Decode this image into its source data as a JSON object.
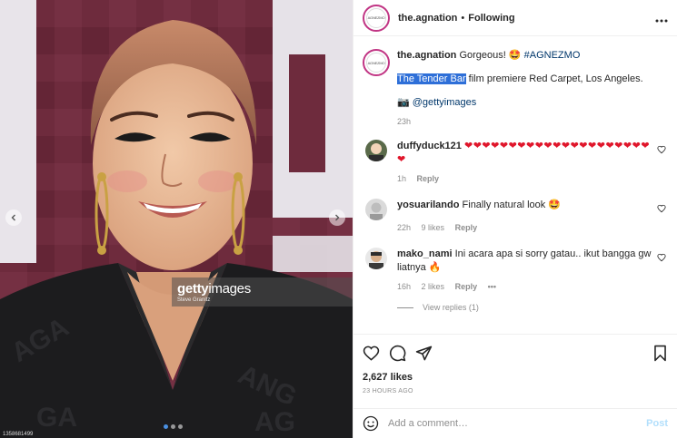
{
  "header": {
    "avatar_text": "AGNEZMO",
    "username": "the.agnation",
    "separator": "•",
    "follow_status": "Following",
    "more_icon": "more-horizontal-icon"
  },
  "media": {
    "watermark_logo_bold": "getty",
    "watermark_logo_light": "images",
    "watermark_credit": "Steve Granitz",
    "image_id": "1358681499",
    "slide_count": 3,
    "active_slide": 1
  },
  "caption": {
    "username": "the.agnation",
    "text": "Gorgeous! 🤩",
    "hashtag": "#AGNEZMO",
    "highlighted": "The Tender Bar",
    "line2_rest": " film premiere Red Carpet, Los Angeles.",
    "camera_emoji": "📷",
    "mention": "@gettyimages",
    "time": "23h"
  },
  "comments": [
    {
      "username": "duffyduck121",
      "text": "❤❤❤❤❤❤❤❤❤❤❤❤❤❤❤❤❤❤❤❤❤❤",
      "time": "1h",
      "likes": "",
      "reply_label": "Reply"
    },
    {
      "username": "yosuarilando",
      "text": "Finally natural look 🤩",
      "time": "22h",
      "likes": "9 likes",
      "reply_label": "Reply"
    },
    {
      "username": "mako_nami",
      "text": "Ini acara apa si sorry gatau.. ikut bangga gw liatnya 🔥",
      "time": "16h",
      "likes": "2 likes",
      "reply_label": "Reply",
      "more": "•••",
      "view_replies": "View replies (1)"
    }
  ],
  "actions": {
    "likes": "2,627 likes",
    "ago": "23 HOURS AGO"
  },
  "add_comment": {
    "placeholder": "Add a comment…",
    "post_label": "Post"
  },
  "colors": {
    "accent_blue": "#0095f6",
    "post_disabled": "#b2dffc",
    "heart_red": "#e0162b",
    "highlight": "#2e6fd8",
    "backdrop": "#6b2a3a"
  }
}
